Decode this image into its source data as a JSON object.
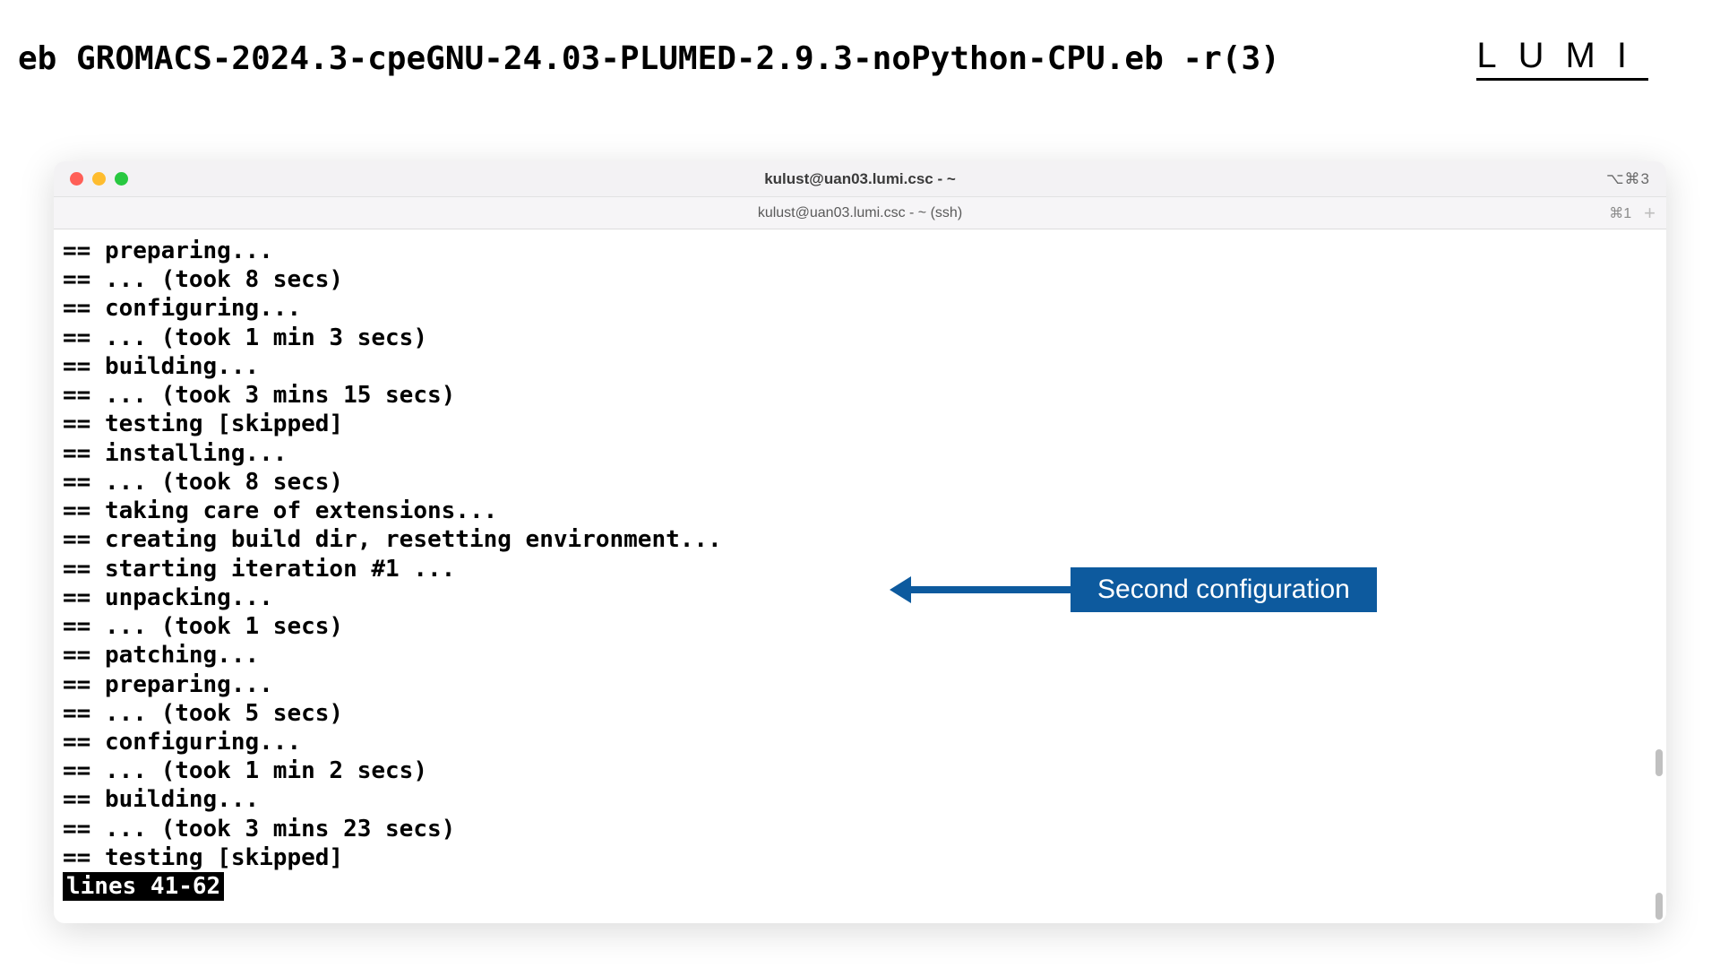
{
  "header": {
    "title": "eb GROMACS-2024.3-cpeGNU-24.03-PLUMED-2.9.3-noPython-CPU.eb -r(3)",
    "logo": "LUMI"
  },
  "window": {
    "title": "kulust@uan03.lumi.csc - ~",
    "titlebar_shortcut": "⌥⌘3",
    "tab_title": "kulust@uan03.lumi.csc - ~ (ssh)",
    "tab_shortcut": "⌘1",
    "tab_add": "+"
  },
  "terminal": {
    "lines": [
      "== preparing...",
      "== ... (took 8 secs)",
      "== configuring...",
      "== ... (took 1 min 3 secs)",
      "== building...",
      "== ... (took 3 mins 15 secs)",
      "== testing [skipped]",
      "== installing...",
      "== ... (took 8 secs)",
      "== taking care of extensions...",
      "== creating build dir, resetting environment...",
      "== starting iteration #1 ...",
      "== unpacking...",
      "== ... (took 1 secs)",
      "== patching...",
      "== preparing...",
      "== ... (took 5 secs)",
      "== configuring...",
      "== ... (took 1 min 2 secs)",
      "== building...",
      "== ... (took 3 mins 23 secs)",
      "== testing [skipped]"
    ],
    "status": "lines 41-62"
  },
  "annotation": {
    "label": "Second configuration"
  }
}
